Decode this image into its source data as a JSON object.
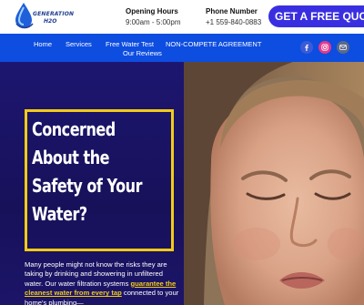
{
  "header": {
    "logo_line1": "GENERATION",
    "logo_line2": "H2O",
    "hours_label": "Opening Hours",
    "hours_value": "9:00am - 5:00pm",
    "phone_label": "Phone Number",
    "phone_value": "+1 559-840-0883",
    "quote_button": "GET A FREE QUOTE"
  },
  "nav": {
    "items": [
      "Home",
      "Services",
      "Free Water Test",
      "NON-COMPETE AGREEMENT",
      "Our Reviews"
    ],
    "social": [
      "facebook-icon",
      "instagram-icon",
      "mail-icon"
    ]
  },
  "hero": {
    "headline_lines": [
      "Concerned",
      "About the",
      "Safety of Your",
      "Water?"
    ],
    "description_part1": "Many people might not know the risks they are taking by drinking and showering in unfiltered water. Our water filtration systems ",
    "description_highlight": "guarantee the cleanest water from every tap",
    "description_part2": " connected to your home's plumbing—"
  },
  "colors": {
    "accent_blue": "#0d4de0",
    "quote_button": "#3a2fe0",
    "hero_bg": "#1b1466",
    "highlight_yellow": "#f3cb16"
  }
}
